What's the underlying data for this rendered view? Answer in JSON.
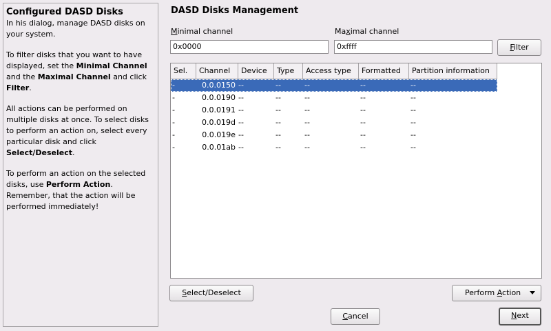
{
  "help": {
    "title": "Configured DASD Disks",
    "p1": "In his dialog, manage DASD disks on your system.",
    "p2_pre": "To filter disks that you want to have displayed, set the ",
    "p2_min": "Minimal Channel",
    "p2_mid": " and the ",
    "p2_max": "Maximal Channel",
    "p2_post": " and click ",
    "p2_filter": "Filter",
    "p2_end": ".",
    "p3_pre": "All actions can be performed on multiple disks at once. To select disks to perform an action on, select every particular disk and click ",
    "p3_sel": "Select/Deselect",
    "p3_end": ".",
    "p4_pre": "To perform an action on the selected disks, use ",
    "p4_act": "Perform Action",
    "p4_end": ". Remember, that the action will be performed immediately!"
  },
  "main": {
    "title": "DASD Disks Management",
    "min_label_key": "M",
    "min_label_rest": "inimal channel",
    "max_label_pre": "Ma",
    "max_label_key": "x",
    "max_label_rest": "imal channel",
    "min_value": "0x0000",
    "max_value": "0xffff",
    "filter_key": "F",
    "filter_rest": "ilter"
  },
  "table": {
    "columns": [
      "Sel.",
      "Channel",
      "Device",
      "Type",
      "Access type",
      "Formatted",
      "Partition information"
    ],
    "rows": [
      [
        "-",
        "0.0.0150",
        "--",
        "--",
        "--",
        "--",
        "--"
      ],
      [
        "-",
        "0.0.0190",
        "--",
        "--",
        "--",
        "--",
        "--"
      ],
      [
        "-",
        "0.0.0191",
        "--",
        "--",
        "--",
        "--",
        "--"
      ],
      [
        "-",
        "0.0.019d",
        "--",
        "--",
        "--",
        "--",
        "--"
      ],
      [
        "-",
        "0.0.019e",
        "--",
        "--",
        "--",
        "--",
        "--"
      ],
      [
        "-",
        "0.0.01ab",
        "--",
        "--",
        "--",
        "--",
        "--"
      ]
    ],
    "selected_row": 0
  },
  "buttons": {
    "select_key": "S",
    "select_rest": "elect/Deselect",
    "perform_pre": "Perform ",
    "perform_key": "A",
    "perform_rest": "ction",
    "cancel_key": "C",
    "cancel_rest": "ancel",
    "next_key": "N",
    "next_rest": "ext"
  },
  "colors": {
    "selection": "#3a6ab8",
    "background": "#eeeaee"
  }
}
